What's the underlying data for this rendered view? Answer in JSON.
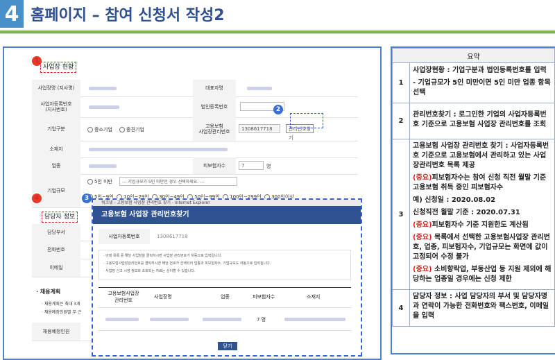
{
  "header": {
    "number": "4",
    "title": "홈페이지 – 참여 신청서 작성2"
  },
  "screenshot": {
    "section1_title": "사업장 현황",
    "section4_title": "담당자 정보",
    "fields": {
      "biz_name": "사업장명 (지사명)",
      "rep": "대표자명",
      "biz_reg_no": "사업자등록번호\n(지사번호)",
      "corp_reg_no": "법인등록번호",
      "company_type": "기업구분",
      "sme": "중소기업",
      "mid": "중견기업",
      "ins_mgmt_no": "고용보험\n사업장관리번호",
      "ins_mgmt_value": "1308617718",
      "mgmt_lookup_btn": "관리번호찾기",
      "address": "소재지",
      "industry": "업종",
      "insured_count": "피보험자수",
      "insured_value": "7",
      "insured_unit": "명",
      "company_size": "기업규모",
      "size_under5": "5인 미만",
      "size_select": "--- 기업규모가 5인 미만인 경우 선택하세요. ---",
      "size_opts": [
        "5인~9인",
        "10인~29인",
        "30인~49인",
        "50인~99인",
        "100인~299인",
        "300인이상"
      ],
      "dept": "담당부서",
      "phone": "전화번호",
      "email": "이메일",
      "plan": "· 채용계획",
      "plan_note1": "· 채용계획은 최대 3개",
      "plan_note2": "· 채용예정인원별 무 근",
      "hire_count": "채용예정인원"
    },
    "popup": {
      "window_bar": "워크넷 - 고용보험 사업장 관리번호 찾기 - Internet Explorer",
      "title": "고용보험 사업장 관리번호찾기",
      "biz_no_label": "사업자등록번호",
      "biz_no_value": "1308617718",
      "notes": [
        "· 아래 목록 중 해당 사업장을 클릭하시면 사업장 관리번호가 자동으로 입력됩니다.",
        "· 고용보험사업장관리번호를 클릭하시면 해당 번호가 선택되어 업종과 피보험자수, 기업규모도 자동으로 입력됩니다.",
        "· 사업장 신고 시점 정보와 조회되는 자료는 상이할 수 있습니다."
      ],
      "columns": [
        "고용보험사업장\n관리번호",
        "사업장명",
        "업종",
        "피보험자수",
        "소재지"
      ],
      "row_insured": "7 명",
      "close_btn": "닫기"
    },
    "badges": [
      "1",
      "2",
      "3",
      "4"
    ]
  },
  "summary": {
    "header": "요약",
    "rows": [
      {
        "no": "1",
        "paras": [
          {
            "text": "사업장현황 : 기업구분과 법인등록번호를 입력",
            "red": false
          },
          {
            "text": " - 기업규모가 5인 미만이면 5인 미만 업종 항목 선택",
            "red": false
          }
        ]
      },
      {
        "no": "2",
        "paras": [
          {
            "text": "관리번호찾기 : 로그인한 기업의 사업자등록번호 기준으로 고용보험 사업장 관리번호를 조회",
            "red": false
          }
        ]
      },
      {
        "no": "3",
        "paras": [
          {
            "text": "고용보험 사업장 관리번호 찾기 : 사업자등록번호 기준으로 고용보험에서 관리하고 있는 사업장관리번호 목록 제공",
            "red": false
          },
          {
            "lead": "(중요)",
            "text": "피보험자수는 참여 신청 직전 월말 기준 고용보험 취득 중인 피보험자수",
            "red": true
          },
          {
            "text": "    예) 신청일 : 2020.08.02",
            "red": false
          },
          {
            "text": "          신청직전 월말 기준 : 2020.07.31",
            "red": false
          },
          {
            "lead": "(중요)",
            "text": "피보험자수 기준 지원한도 계산됨",
            "red": true
          },
          {
            "lead": "(중요)",
            "text": " 목록에서 선택한 고용보험사업장 관리번호, 업종, 피보험자수, 기업규모는 화면에 값이 고정되어 수정 불가",
            "red": true
          },
          {
            "lead": "(중요)",
            "text": " 소비향락업, 부동산업 등 지원 제외에 해당하는 업종일 경우에는 신청 제한",
            "red": true
          }
        ]
      },
      {
        "no": "4",
        "paras": [
          {
            "text": "담당자 정보 : 사업 담당자의 부서 및 담당자명과 연락이 가능한 전화번호와 팩스번호, 이메일을 입력",
            "red": false
          }
        ]
      }
    ]
  }
}
